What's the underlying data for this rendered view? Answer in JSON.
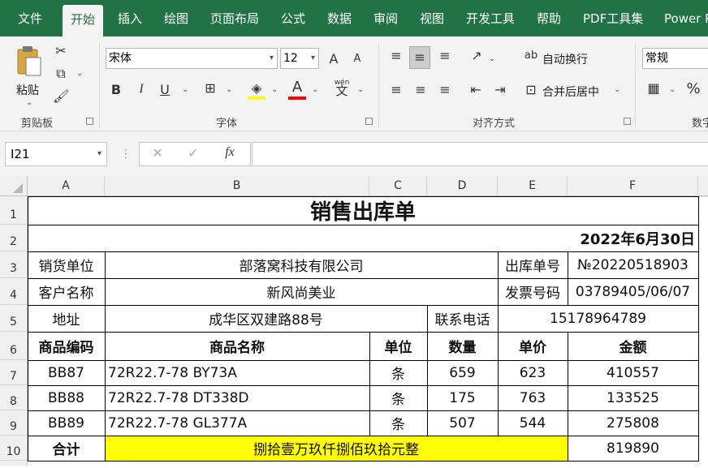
{
  "ribbon_tabs": [
    "文件",
    "开始",
    "插入",
    "绘图",
    "页面布局",
    "公式",
    "数据",
    "审阅",
    "视图",
    "开发工具",
    "帮助",
    "PDF工具集",
    "Power P"
  ],
  "active_tab": "开始",
  "clipboard": {
    "paste_label": "粘贴",
    "group_label": "剪贴板"
  },
  "font": {
    "name": "宋体",
    "size": "12",
    "bold": "B",
    "italic": "I",
    "underline": "U",
    "font_color_glyph": "A",
    "pinyin_glyph": "wén",
    "grow_glyph": "A",
    "shrink_glyph": "A",
    "group_label": "字体"
  },
  "alignment": {
    "wrap_text": "自动换行",
    "merge_center": "合并后居中",
    "group_label": "对齐方式"
  },
  "number": {
    "format": "常规",
    "percent": "%",
    "group_label": "数字"
  },
  "formula_bar": {
    "name_box": "I21",
    "fx": "fx",
    "formula": ""
  },
  "colors": {
    "ribbon_green": "#217346",
    "highlight_yellow": "#ffff00",
    "font_red": "#ff0000"
  },
  "columns": [
    "A",
    "B",
    "C",
    "D",
    "E",
    "F"
  ],
  "rows": [
    "1",
    "2",
    "3",
    "4",
    "5",
    "6",
    "7",
    "8",
    "9",
    "10"
  ],
  "sheet": {
    "title": "销售出库单",
    "date": "2022年6月30日",
    "seller_label": "销货单位",
    "seller_value": "部落窝科技有限公司",
    "order_no_label": "出库单号",
    "order_no_value": "№20220518903",
    "customer_label": "客户名称",
    "customer_value": "新风尚美业",
    "invoice_label": "发票号码",
    "invoice_value": "03789405/06/07",
    "address_label": "地址",
    "address_value": "成华区双建路88号",
    "phone_label": "联系电话",
    "phone_value": "15178964789",
    "headers": [
      "商品编码",
      "商品名称",
      "单位",
      "数量",
      "单价",
      "金额"
    ],
    "items": [
      {
        "code": "BB87",
        "name": "72R22.7-78 BY73A",
        "unit": "条",
        "qty": "659",
        "price": "623",
        "amount": "410557"
      },
      {
        "code": "BB88",
        "name": "72R22.7-78 DT338D",
        "unit": "条",
        "qty": "175",
        "price": "763",
        "amount": "133525"
      },
      {
        "code": "BB89",
        "name": "72R22.7-78 GL377A",
        "unit": "条",
        "qty": "507",
        "price": "544",
        "amount": "275808"
      }
    ],
    "total_label": "合计",
    "total_words": "捌拾壹万玖仟捌佰玖拾元整",
    "total_amount": "819890"
  }
}
